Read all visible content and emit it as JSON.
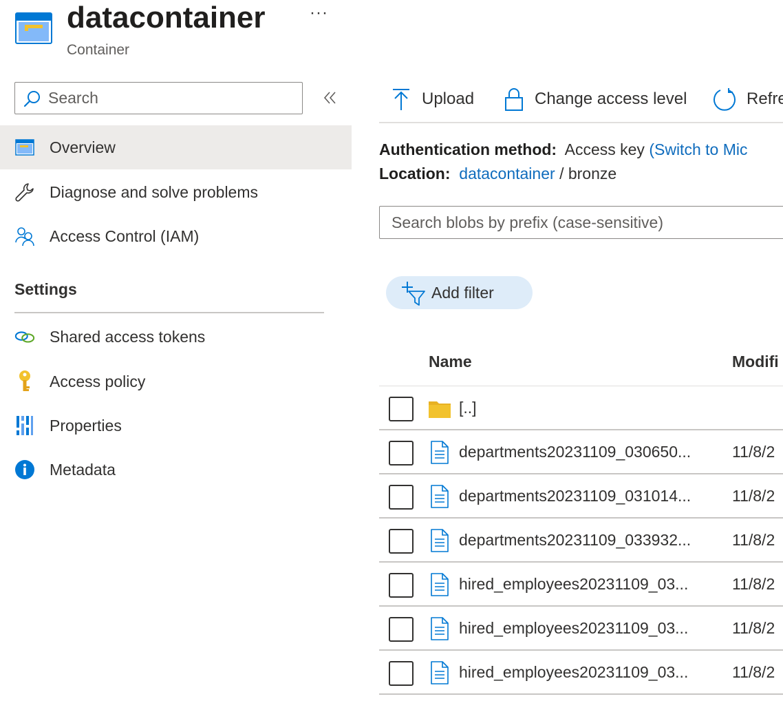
{
  "header": {
    "title": "datacontainer",
    "subtitle": "Container",
    "more": "···",
    "icon": "storage-container-icon"
  },
  "sidebar": {
    "search_placeholder": "Search",
    "collapse_icon": "double-chevron-left-icon",
    "items": [
      {
        "label": "Overview",
        "icon": "container-overview-icon",
        "active": true
      },
      {
        "label": "Diagnose and solve problems",
        "icon": "wrench-icon"
      },
      {
        "label": "Access Control (IAM)",
        "icon": "people-icon"
      }
    ],
    "settings_heading": "Settings",
    "settings_items": [
      {
        "label": "Shared access tokens",
        "icon": "link-chain-icon"
      },
      {
        "label": "Access policy",
        "icon": "key-icon"
      },
      {
        "label": "Properties",
        "icon": "properties-bars-icon"
      },
      {
        "label": "Metadata",
        "icon": "info-icon"
      }
    ]
  },
  "toolbar": {
    "upload": "Upload",
    "change_access": "Change access level",
    "refresh": "Refre"
  },
  "info": {
    "auth_label": "Authentication method:",
    "auth_value": "Access key",
    "auth_link": "(Switch to Mic",
    "location_label": "Location:",
    "location_link": "datacontainer",
    "location_sep": "/",
    "location_folder": "bronze"
  },
  "blob_search": {
    "placeholder": "Search blobs by prefix (case-sensitive)"
  },
  "filter": {
    "label": "Add filter"
  },
  "table": {
    "columns": [
      "Name",
      "Modifi"
    ],
    "rows": [
      {
        "name": "[..]",
        "modified": "",
        "type": "folder"
      },
      {
        "name": "departments20231109_030650...",
        "modified": "11/8/2",
        "type": "file"
      },
      {
        "name": "departments20231109_031014...",
        "modified": "11/8/2",
        "type": "file"
      },
      {
        "name": "departments20231109_033932...",
        "modified": "11/8/2",
        "type": "file"
      },
      {
        "name": "hired_employees20231109_03...",
        "modified": "11/8/2",
        "type": "file"
      },
      {
        "name": "hired_employees20231109_03...",
        "modified": "11/8/2",
        "type": "file"
      },
      {
        "name": "hired_employees20231109_03...",
        "modified": "11/8/2",
        "type": "file"
      }
    ]
  },
  "colors": {
    "accent": "#0f6cbd",
    "active_bg": "#edebe9",
    "filter_bg": "#deecf9",
    "folder": "#f2c22d"
  }
}
